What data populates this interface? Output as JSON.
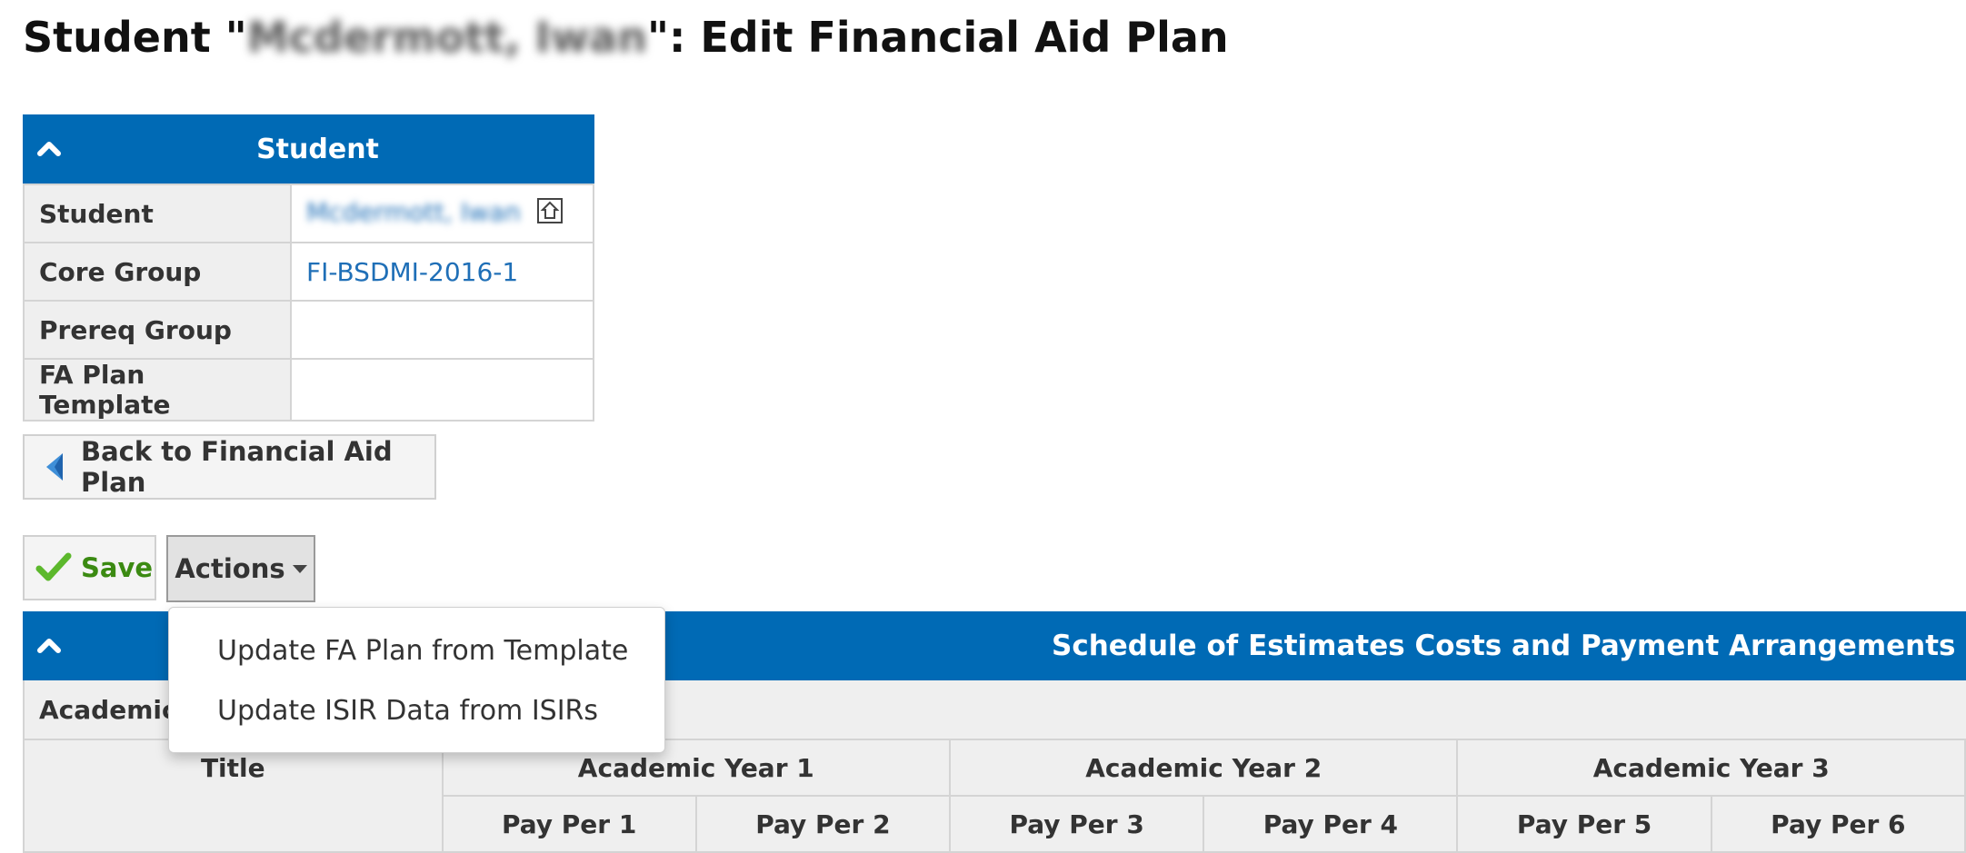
{
  "page": {
    "title_prefix": "Student \"",
    "student_name": "Mcdermott, Iwan",
    "title_suffix": "\": Edit Financial Aid Plan"
  },
  "student_panel": {
    "header": "Student",
    "rows": [
      {
        "label": "Student",
        "value": "Mcdermott, Iwan"
      },
      {
        "label": "Core Group",
        "value": "FI-BSDMI-2016-1"
      },
      {
        "label": "Prereq Group",
        "value": ""
      },
      {
        "label": "FA Plan Template",
        "value": ""
      }
    ]
  },
  "buttons": {
    "back": "Back to Financial Aid Plan",
    "save": "Save",
    "actions": "Actions"
  },
  "actions_menu": {
    "items": [
      "Update FA Plan from Template",
      "Update ISIR Data from ISIRs"
    ]
  },
  "schedule": {
    "header": "Schedule of Estimates Costs and Payment Arrangements",
    "academic_label": "Academic",
    "title_header": "Title",
    "years": [
      "Academic Year 1",
      "Academic Year 2",
      "Academic Year 3"
    ],
    "pay_periods": [
      "Pay Per 1",
      "Pay Per 2",
      "Pay Per 3",
      "Pay Per 4",
      "Pay Per 5",
      "Pay Per 6"
    ]
  },
  "colors": {
    "header_blue": "#006ab5",
    "link_blue": "#1f6fb7",
    "save_green": "#3b8a12"
  }
}
